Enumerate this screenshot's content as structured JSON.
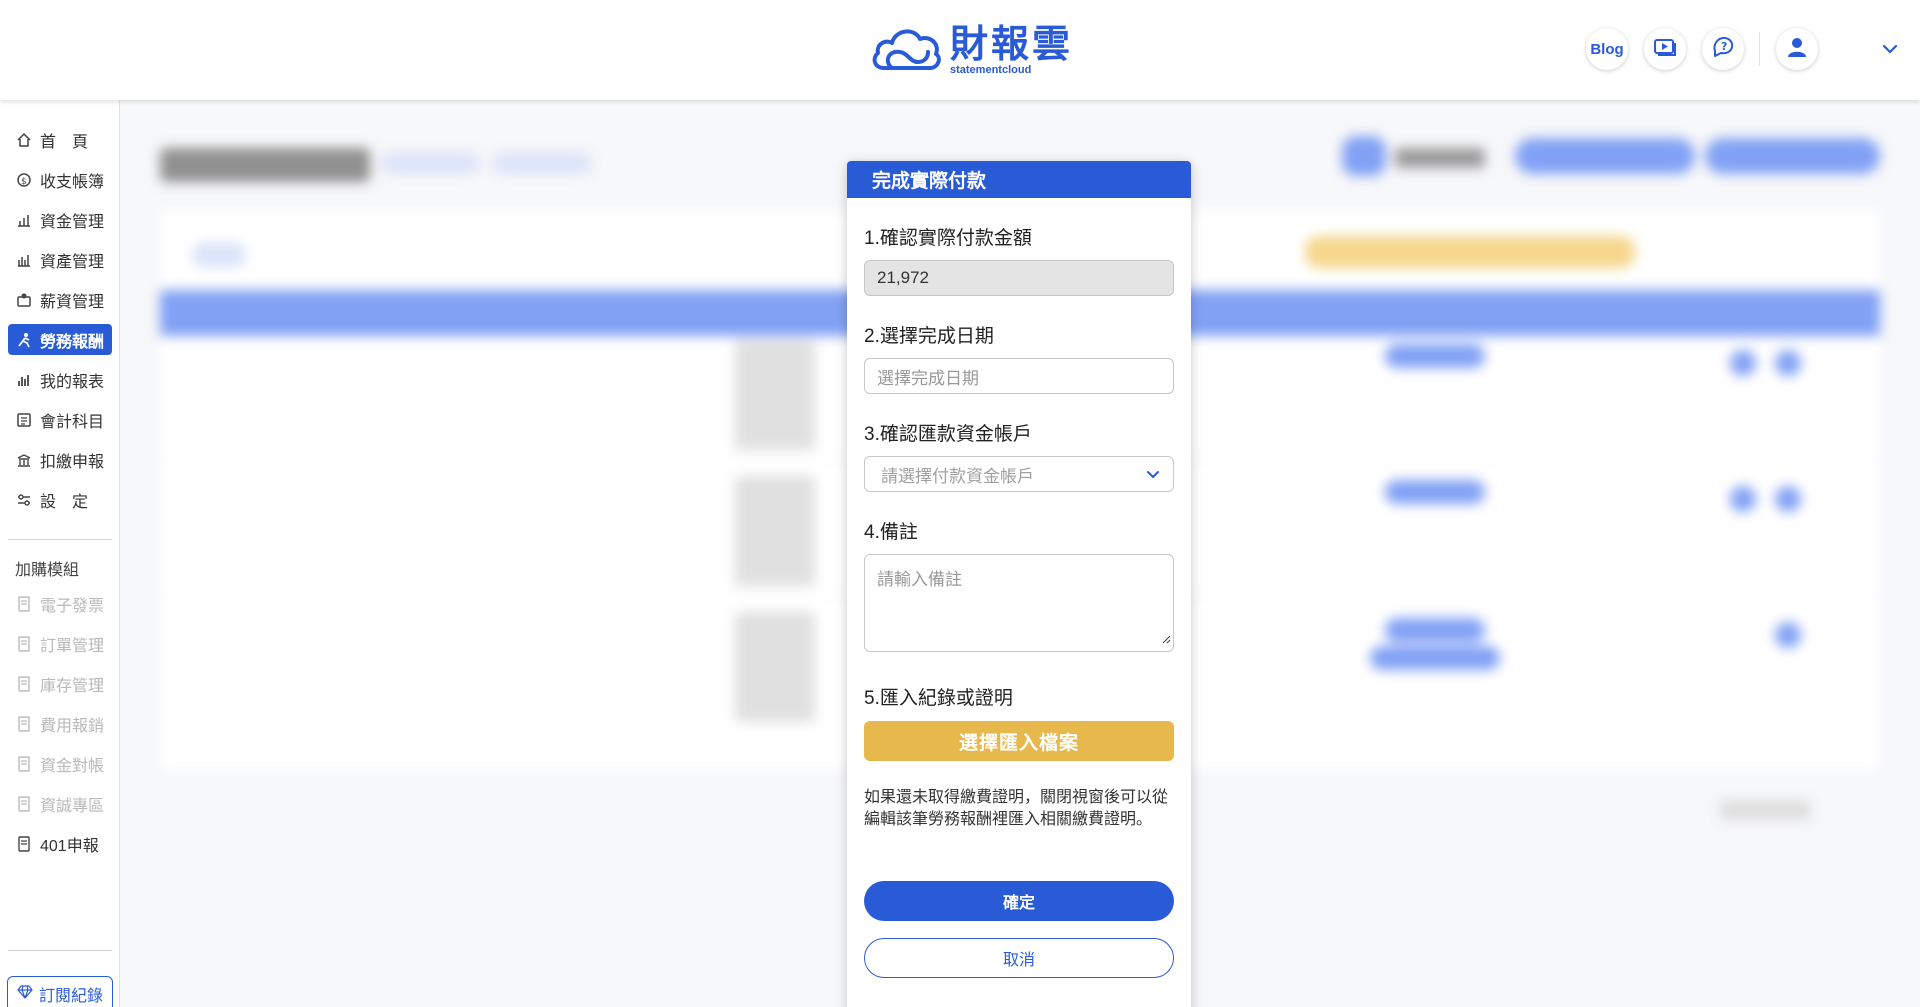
{
  "header": {
    "logo_cn": "財報雲",
    "logo_en": "statementcloud",
    "blog_label": "Blog",
    "icons": [
      "video-tutorial-icon",
      "support-chat-icon",
      "user-icon",
      "chevron-down-icon"
    ]
  },
  "sidebar": {
    "items": [
      {
        "label": "首　頁",
        "icon": "home-icon",
        "state": "normal"
      },
      {
        "label": "收支帳簿",
        "icon": "ledger-icon",
        "state": "normal"
      },
      {
        "label": "資金管理",
        "icon": "fund-icon",
        "state": "normal"
      },
      {
        "label": "資產管理",
        "icon": "asset-icon",
        "state": "normal"
      },
      {
        "label": "薪資管理",
        "icon": "payroll-icon",
        "state": "normal"
      },
      {
        "label": "勞務報酬",
        "icon": "labor-icon",
        "state": "active"
      },
      {
        "label": "我的報表",
        "icon": "report-icon",
        "state": "normal"
      },
      {
        "label": "會計科目",
        "icon": "accounts-icon",
        "state": "normal"
      },
      {
        "label": "扣繳申報",
        "icon": "withholding-icon",
        "state": "normal"
      },
      {
        "label": "設　定",
        "icon": "settings-icon",
        "state": "normal"
      }
    ],
    "addon_title": "加購模組",
    "addon_items": [
      {
        "label": "電子發票",
        "state": "disabled"
      },
      {
        "label": "訂單管理",
        "state": "disabled"
      },
      {
        "label": "庫存管理",
        "state": "disabled"
      },
      {
        "label": "費用報銷",
        "state": "disabled"
      },
      {
        "label": "資金對帳",
        "state": "disabled"
      },
      {
        "label": "資誠專區",
        "state": "disabled"
      },
      {
        "label": "401申報",
        "state": "normal"
      }
    ],
    "subscription_label": "訂閱紀錄"
  },
  "modal": {
    "title": "完成實際付款",
    "step1_label": "1.確認實際付款金額",
    "amount_value": "21,972",
    "step2_label": "2.選擇完成日期",
    "date_placeholder": "選擇完成日期",
    "step3_label": "3.確認匯款資金帳戶",
    "account_placeholder": "請選擇付款資金帳戶",
    "step4_label": "4.備註",
    "note_placeholder": "請輸入備註",
    "step5_label": "5.匯入紀錄或證明",
    "upload_label": "選擇匯入檔案",
    "hint": "如果還未取得繳費證明，關閉視窗後可以從編輯該筆勞務報酬裡匯入相關繳費證明。",
    "confirm_label": "確定",
    "cancel_label": "取消"
  },
  "colors": {
    "brand_blue": "#2a5bd7",
    "upload_yellow": "#e7b94c",
    "readonly_gray": "#e4e4e4"
  }
}
